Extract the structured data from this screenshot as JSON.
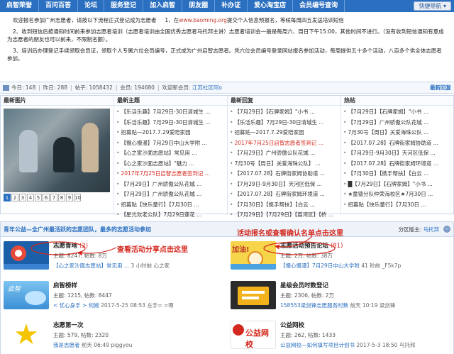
{
  "nav": {
    "items": [
      "启智荣誉",
      "百问百答",
      "论坛",
      "服务登记",
      "加入启智",
      "朋友圈",
      "补办证",
      "爱心淘宝店",
      "会员编号查询"
    ],
    "quick_nav": "快捷导航 ▾"
  },
  "notice": {
    "p1_a": "欢迎报名参加广州志愿者，请按以下流程正式登记成为志愿者",
    "p1_b": "1、在",
    "p1_link": "www.baoming.org",
    "p1_c": "提交个人信息预报名，等候每周四五发送培训短信",
    "p2": "2、收到短信后按通知时间前来参加志愿者培训（志愿者培训由全国优秀志愿者马托邦主讲）志愿者培训会一般是每周六、周日下午15:00，其他时间不进行。（没有收到短信通知有意成为志愿者的朋友也可以前来，不限制名额）。",
    "p3": "3、培训后办理登记手续领取会员证，领取个人专属六位会员编号，正式成为广州启智志愿者。凭六位会员编号登录网站报名参加活动，每周提供五十多个活动，八百多个供全体志愿者参加。"
  },
  "stats": {
    "today": "今日: 148",
    "yesterday": "昨日: 288",
    "posts": "帖子: 1058432",
    "members": "会员: 194680",
    "welcome_prefix": "欢迎新会员:",
    "new_member": "江苏社区阿o",
    "latest": "最新回复"
  },
  "columns": {
    "photo_head": "最新图片",
    "topics_head": "最新主题",
    "replies_head": "最新回复",
    "hot_head": "热帖",
    "pager": [
      "1",
      "2",
      "3",
      "4",
      "5",
      "6",
      "7",
      "8",
      "9",
      "10"
    ],
    "topics": [
      {
        "text": "【乐活乐趣】7月29日-30日清城生 ...",
        "red": false
      },
      {
        "text": "【乐活乐趣】7月29日-30日清城生 ...",
        "red": false
      },
      {
        "text": "招募贴—2017.7.29爱陪家园",
        "red": false
      },
      {
        "text": "【慢心慢漫】7月29日中山大学附 ...",
        "red": false
      },
      {
        "text": "【心之家沙面志愿站】常见用 ...",
        "red": false
      },
      {
        "text": "【心之家沙面志愿站】\"魅力 ...",
        "red": false
      },
      {
        "text": "2017年7月25日启智志愿者签到记 ...",
        "red": true
      },
      {
        "text": "【7月29日】广州骄傲公队花城 ...",
        "red": false
      },
      {
        "text": "【7月29日】广州骄傲公队花城 ...",
        "red": false
      },
      {
        "text": "招募贴【快乐童行】【7月30日 ...",
        "red": false
      },
      {
        "text": "【星光欢老公队】7月29日莲花 ...",
        "red": false
      }
    ],
    "replies": [
      {
        "text": "【7月29日】【石牌家姆】\"小书 ...",
        "red": false
      },
      {
        "text": "【乐活乐趣】7月29日-30日清城生 ...",
        "red": false
      },
      {
        "text": "招募贴—2017.7.29爱陪家园",
        "red": false
      },
      {
        "text": "2017年7月25日启智志愿者签到记 ...",
        "red": true
      },
      {
        "text": "【7月29日】广州骄傲公队花城 ...",
        "red": false
      },
      {
        "text": "7月30号【周日】关爱海珠公队】 ...",
        "red": false
      },
      {
        "text": "【2017.07.28】石牌街家姆协助道 ...",
        "red": false
      },
      {
        "text": "【7月29日-9月30日】天河区低保 ...",
        "red": false
      },
      {
        "text": "【2017.07.28】石牌街家姆环境道 ...",
        "red": false
      },
      {
        "text": "【7月30日】【携手帮扶】【白云 ...",
        "red": false
      },
      {
        "text": "【7月29日】【7月29日】【荔湾区】【桥 ...",
        "red": false
      }
    ],
    "hot": [
      {
        "text": "【7月29日】【石牌家姆】\"小书 ...",
        "red": false
      },
      {
        "text": "【7月29日】广州骄傲公队花城 ...",
        "red": false
      },
      {
        "text": "7月30号【周日】关爱海珠公队 ...",
        "red": false
      },
      {
        "text": "【2017.07.28】石牌街家姆协助道 ...",
        "red": false
      },
      {
        "text": "【7月29日-9月30日】天河区低保 ...",
        "red": false
      },
      {
        "text": "【2017.07.28】石牌街家姆环境道 ...",
        "red": false
      },
      {
        "text": "【7月30日】【携手帮扶】【白云 ...",
        "red": false
      },
      {
        "text": "█【7月29日】【石牌家姆】\"小书 ...",
        "red": false
      },
      {
        "text": "★童德分队仲荣海校区★7月30日 ...",
        "red": false
      },
      {
        "text": "招募贴【快乐童行】【7月30日 ...",
        "red": false
      }
    ]
  },
  "forum_section": {
    "title": "青年公益—全广州最活跃的志愿团队，最多的志愿活动参加",
    "mod_label": "分区版主:",
    "mod_name": "乌托邦",
    "collapse": "−"
  },
  "forums": [
    {
      "name": "志愿青地",
      "count": "(2)",
      "meta": "主题: 8247, 帖数: 8万",
      "last": "【心之家沙面志愿站】常见用 ...",
      "last_extra": "3 小时前 心之家",
      "thumb": "flag"
    },
    {
      "name": "志愿活动预告论坛",
      "count": "(81)",
      "meta": "主题: 2万, 帖数: 38万",
      "last": "【慢心慢漫】7月29日中山大学附",
      "last_extra": "41 秒前 _F5k7p",
      "thumb": "cheer"
    },
    {
      "name": "启智榜样",
      "count": "",
      "meta": "主题: 1215, 帖数: 8447",
      "last": "< 忧心身手 > 何婉",
      "last_extra": "2017-5-25 08:53 左手= =嗯",
      "thumb": "sky"
    },
    {
      "name": "星级会员时数登记",
      "count": "",
      "meta": "主题: 2306, 帖数: 2万",
      "last": "158553梁剑锋志愿服务时数",
      "last_extra": "前天 10:19 梁剑锋",
      "thumb": "book"
    },
    {
      "name": "志愿第一次",
      "count": "",
      "meta": "主题: 579, 帖数: 2320",
      "last": "我是志愿者",
      "last_extra": "前天 06:49 piggyou",
      "thumb": "star"
    },
    {
      "name": "公益网校",
      "count": "",
      "meta": "主题: 262, 帖数: 1433",
      "last": "公益网校—如何填写项目计划书",
      "last_extra": "2017-5-3 18:50 乌托邦",
      "thumb": "school"
    }
  ],
  "annotations": {
    "share": "查看活动分享点击这里",
    "signup": "活动报名或查看确认名单点击这里"
  }
}
